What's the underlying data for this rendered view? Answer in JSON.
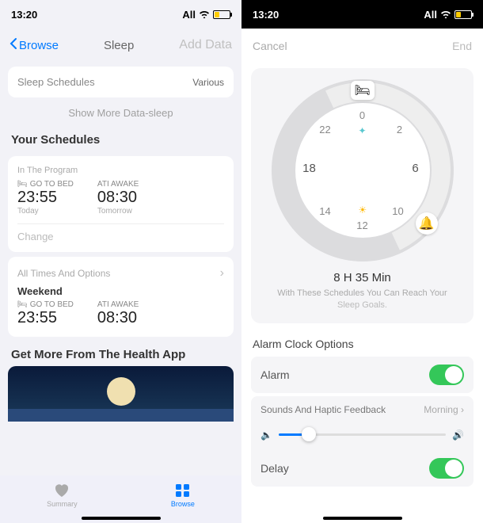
{
  "status": {
    "time": "13:20",
    "carrier": "All"
  },
  "left": {
    "nav": {
      "back": "Browse",
      "title": "Sleep",
      "action": "Add Data"
    },
    "schedules_row": {
      "label": "Sleep Schedules",
      "value": "Various"
    },
    "show_more": "Show More Data-sleep",
    "your_schedules": "Your Schedules",
    "program_label": "In The Program",
    "bed_label": "GO TO BED",
    "wake_label": "ATI AWAKE",
    "prog": {
      "bed": "23:55",
      "bed_day": "Today",
      "wake": "08:30",
      "wake_day": "Tomorrow"
    },
    "change": "Change",
    "all_times": "All Times And Options",
    "weekend_label": "Weekend",
    "weekend": {
      "bed": "23:55",
      "wake": "08:30"
    },
    "health_title": "Get More From The Health App",
    "tabs": {
      "summary": "Summary",
      "browse": "Browse"
    }
  },
  "right": {
    "sheet": {
      "cancel": "Cancel",
      "end": "End"
    },
    "clock": {
      "n0": "0",
      "n2": "2",
      "n6": "6",
      "n10": "10",
      "n12": "12",
      "n14": "14",
      "n18": "18",
      "n22": "22"
    },
    "duration": "8 H 35 Min",
    "duration_sub1": "With These Schedules You Can Reach Your",
    "duration_sub2": "Sleep Goals.",
    "alarm_section": "Alarm Clock Options",
    "alarm_label": "Alarm",
    "sounds_label": "Sounds And Haptic Feedback",
    "sounds_value": "Morning",
    "delay_label": "Delay"
  }
}
